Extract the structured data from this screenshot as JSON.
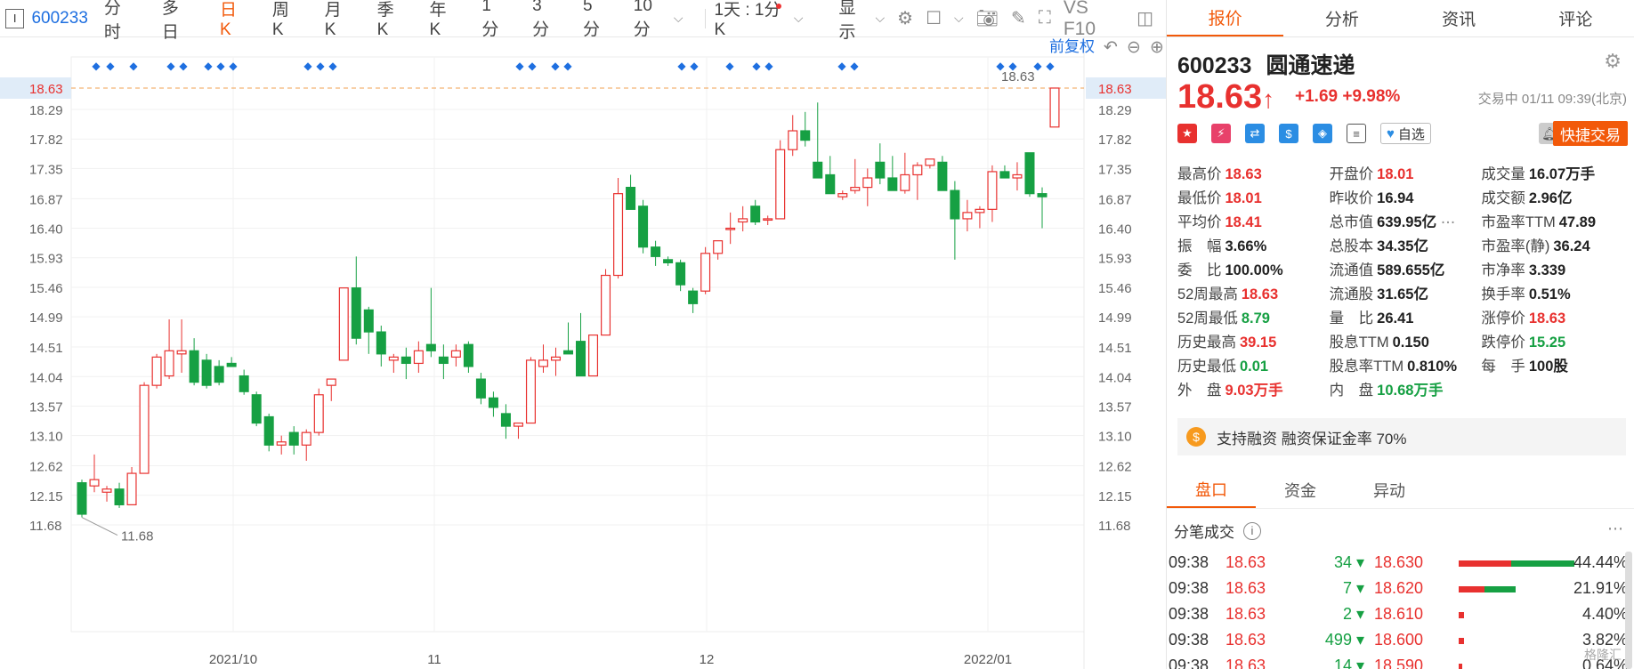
{
  "toolbar": {
    "code": "600233",
    "periods": [
      "分时",
      "多日",
      "日K",
      "周K",
      "月K",
      "季K",
      "年K",
      "1分",
      "3分",
      "5分",
      "10分"
    ],
    "interval": "1天 : 1分K",
    "show_label": "显示",
    "indicators": "VS F10",
    "fq_label": "前复权"
  },
  "right": {
    "tabs": [
      "报价",
      "分析",
      "资讯",
      "评论"
    ],
    "code": "600233",
    "name": "圆通速递",
    "price": "18.63",
    "arrow": "↑",
    "change": "+1.69",
    "change_pct": "+9.98%",
    "time": "交易中 01/11 09:39(北京)",
    "zixuan": "自选",
    "fast_trade": "快捷交易",
    "stats": [
      [
        {
          "l": "最高价",
          "v": "18.63",
          "c": "red"
        },
        {
          "l": "开盘价",
          "v": "18.01",
          "c": "red"
        },
        {
          "l": "成交量",
          "v": "16.07万手",
          "c": "dark"
        }
      ],
      [
        {
          "l": "最低价",
          "v": "18.01",
          "c": "red"
        },
        {
          "l": "昨收价",
          "v": "16.94",
          "c": "dark"
        },
        {
          "l": "成交额",
          "v": "2.96亿",
          "c": "dark"
        }
      ],
      [
        {
          "l": "平均价",
          "v": "18.41",
          "c": "red"
        },
        {
          "l": "总市值",
          "v": "639.95亿",
          "c": "dark"
        },
        {
          "l": "市盈率TTM",
          "v": "47.89",
          "c": "dark"
        }
      ],
      [
        {
          "l": "振　幅",
          "v": "3.66%",
          "c": "dark"
        },
        {
          "l": "总股本",
          "v": "34.35亿",
          "c": "dark"
        },
        {
          "l": "市盈率(静)",
          "v": "36.24",
          "c": "dark"
        }
      ],
      [
        {
          "l": "委　比",
          "v": "100.00%",
          "c": "dark"
        },
        {
          "l": "流通值",
          "v": "589.655亿",
          "c": "dark"
        },
        {
          "l": "市净率",
          "v": "3.339",
          "c": "dark"
        }
      ],
      [
        {
          "l": "52周最高",
          "v": "18.63",
          "c": "red"
        },
        {
          "l": "流通股",
          "v": "31.65亿",
          "c": "dark"
        },
        {
          "l": "换手率",
          "v": "0.51%",
          "c": "dark"
        }
      ],
      [
        {
          "l": "52周最低",
          "v": "8.79",
          "c": "green"
        },
        {
          "l": "量　比",
          "v": "26.41",
          "c": "dark"
        },
        {
          "l": "涨停价",
          "v": "18.63",
          "c": "red"
        }
      ],
      [
        {
          "l": "历史最高",
          "v": "39.15",
          "c": "red"
        },
        {
          "l": "股息TTM",
          "v": "0.150",
          "c": "dark"
        },
        {
          "l": "跌停价",
          "v": "15.25",
          "c": "green"
        }
      ],
      [
        {
          "l": "历史最低",
          "v": "0.01",
          "c": "green"
        },
        {
          "l": "股息率TTM",
          "v": "0.810%",
          "c": "dark"
        },
        {
          "l": "每　手",
          "v": "100股",
          "c": "dark"
        }
      ],
      [
        {
          "l": "外　盘",
          "v": "9.03万手",
          "c": "red"
        },
        {
          "l": "内　盘",
          "v": "10.68万手",
          "c": "green"
        },
        {
          "l": "",
          "v": "",
          "c": "dark"
        }
      ]
    ],
    "margin_text": "支持融资 融资保证金率 70%",
    "tabs2": [
      "盘口",
      "资金",
      "异动"
    ],
    "tick_title": "分笔成交",
    "ticks": [
      {
        "t": "09:38",
        "p": "18.63",
        "v": "34",
        "bp": "18.630",
        "pct": "44.44%"
      },
      {
        "t": "09:38",
        "p": "18.63",
        "v": "7",
        "bp": "18.620",
        "pct": "21.91%"
      },
      {
        "t": "09:38",
        "p": "18.63",
        "v": "2",
        "bp": "18.610",
        "pct": "4.40%"
      },
      {
        "t": "09:38",
        "p": "18.63",
        "v": "499",
        "bp": "18.600",
        "pct": "3.82%"
      },
      {
        "t": "09:38",
        "p": "18.63",
        "v": "14",
        "bp": "18.590",
        "pct": "0.64%"
      }
    ],
    "watermark": "格隆汇"
  },
  "chart_data": {
    "type": "candlestick",
    "yticks": [
      "18.29",
      "17.82",
      "17.35",
      "16.87",
      "16.40",
      "15.93",
      "15.46",
      "14.99",
      "14.51",
      "14.04",
      "13.57",
      "13.10",
      "12.62",
      "12.15",
      "11.68"
    ],
    "xlabels": [
      "2021/10",
      "11",
      "12",
      "2022/01"
    ],
    "current_price": "18.63",
    "max_label": "18.63",
    "min_label": "11.68",
    "ohlc": [
      [
        12.35,
        12.4,
        11.8,
        11.85
      ],
      [
        12.3,
        12.8,
        12.2,
        12.4
      ],
      [
        12.2,
        12.3,
        12.05,
        12.25
      ],
      [
        12.25,
        12.35,
        11.95,
        12.0
      ],
      [
        12.0,
        12.6,
        12.0,
        12.5
      ],
      [
        12.5,
        13.95,
        12.5,
        13.9
      ],
      [
        13.9,
        14.4,
        13.85,
        14.35
      ],
      [
        14.05,
        14.95,
        14.0,
        14.45
      ],
      [
        14.4,
        14.95,
        14.1,
        14.45
      ],
      [
        14.45,
        14.65,
        13.9,
        13.95
      ],
      [
        14.3,
        14.4,
        13.85,
        13.9
      ],
      [
        14.2,
        14.3,
        13.9,
        13.95
      ],
      [
        14.25,
        14.35,
        14.2,
        14.2
      ],
      [
        14.05,
        14.15,
        13.75,
        13.8
      ],
      [
        13.75,
        13.8,
        13.25,
        13.3
      ],
      [
        13.4,
        13.45,
        12.85,
        12.95
      ],
      [
        12.95,
        13.1,
        12.8,
        13.0
      ],
      [
        13.15,
        13.25,
        12.8,
        12.95
      ],
      [
        12.95,
        13.2,
        12.7,
        13.15
      ],
      [
        13.15,
        13.85,
        13.1,
        13.75
      ],
      [
        13.9,
        14.0,
        13.65,
        14.0
      ],
      [
        14.3,
        15.45,
        14.3,
        15.45
      ],
      [
        15.45,
        15.95,
        14.55,
        14.65
      ],
      [
        15.1,
        15.15,
        14.4,
        14.75
      ],
      [
        14.75,
        14.85,
        14.2,
        14.4
      ],
      [
        14.3,
        14.4,
        14.1,
        14.35
      ],
      [
        14.35,
        14.5,
        14.0,
        14.25
      ],
      [
        14.25,
        14.6,
        14.1,
        14.45
      ],
      [
        14.55,
        15.45,
        14.35,
        14.45
      ],
      [
        14.35,
        14.55,
        14.0,
        14.25
      ],
      [
        14.35,
        14.55,
        14.2,
        14.45
      ],
      [
        14.55,
        14.6,
        14.1,
        14.2
      ],
      [
        14.0,
        14.1,
        13.6,
        13.7
      ],
      [
        13.7,
        13.8,
        13.4,
        13.55
      ],
      [
        13.45,
        13.6,
        13.05,
        13.25
      ],
      [
        13.25,
        13.3,
        13.05,
        13.3
      ],
      [
        13.3,
        14.35,
        13.3,
        14.3
      ],
      [
        14.2,
        14.55,
        14.1,
        14.3
      ],
      [
        14.3,
        14.5,
        14.05,
        14.35
      ],
      [
        14.45,
        14.9,
        14.4,
        14.4
      ],
      [
        14.6,
        15.05,
        14.3,
        14.05
      ],
      [
        14.05,
        14.65,
        14.05,
        14.7
      ],
      [
        14.7,
        15.75,
        14.7,
        15.65
      ],
      [
        15.65,
        17.2,
        15.6,
        16.95
      ],
      [
        17.05,
        17.25,
        16.7,
        16.7
      ],
      [
        16.75,
        16.85,
        16.0,
        16.1
      ],
      [
        16.1,
        16.2,
        15.8,
        15.95
      ],
      [
        15.9,
        15.95,
        15.8,
        15.85
      ],
      [
        15.85,
        15.9,
        15.4,
        15.5
      ],
      [
        15.4,
        15.45,
        15.05,
        15.2
      ],
      [
        15.4,
        16.1,
        15.35,
        16.0
      ],
      [
        16.0,
        16.2,
        15.9,
        16.2
      ],
      [
        16.4,
        16.65,
        16.15,
        16.4
      ],
      [
        16.5,
        16.75,
        16.35,
        16.55
      ],
      [
        16.75,
        16.85,
        16.45,
        16.5
      ],
      [
        16.55,
        16.6,
        16.45,
        16.55
      ],
      [
        16.55,
        17.8,
        16.55,
        17.65
      ],
      [
        17.65,
        18.2,
        17.55,
        17.95
      ],
      [
        17.95,
        18.25,
        17.7,
        17.8
      ],
      [
        17.45,
        18.4,
        17.2,
        17.2
      ],
      [
        17.25,
        17.55,
        17.0,
        16.95
      ],
      [
        16.9,
        17.0,
        16.85,
        16.95
      ],
      [
        17.0,
        17.5,
        16.95,
        17.05
      ],
      [
        17.05,
        17.35,
        16.75,
        17.2
      ],
      [
        17.45,
        17.75,
        17.1,
        17.2
      ],
      [
        17.2,
        17.55,
        17.0,
        17.0
      ],
      [
        17.0,
        17.6,
        16.95,
        17.25
      ],
      [
        17.25,
        17.45,
        16.85,
        17.4
      ],
      [
        17.4,
        17.5,
        17.35,
        17.5
      ],
      [
        17.45,
        17.55,
        17.0,
        17.0
      ],
      [
        17.0,
        17.15,
        15.9,
        16.55
      ],
      [
        16.55,
        16.85,
        16.35,
        16.65
      ],
      [
        16.65,
        16.75,
        16.4,
        16.7
      ],
      [
        16.7,
        17.4,
        16.5,
        17.3
      ],
      [
        17.3,
        17.4,
        17.2,
        17.2
      ],
      [
        17.2,
        17.45,
        17.0,
        17.25
      ],
      [
        17.6,
        17.6,
        16.9,
        16.95
      ],
      [
        16.95,
        17.05,
        16.4,
        16.9
      ],
      [
        18.01,
        18.63,
        18.01,
        18.63
      ]
    ]
  }
}
